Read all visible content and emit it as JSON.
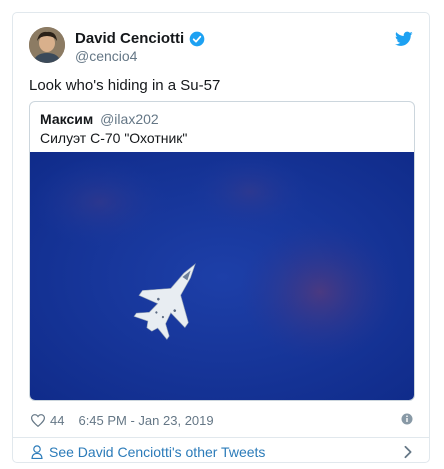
{
  "tweet": {
    "author": {
      "name": "David Cenciotti",
      "handle": "@cencio4"
    },
    "text": "Look who's hiding in a Su-57",
    "quoted": {
      "author_name": "Максим",
      "handle": "@ilax202",
      "text": "Силуэт С-70 \"Охотник\""
    },
    "likes": "44",
    "timestamp": "6:45 PM - Jan 23, 2019"
  },
  "footer": {
    "link_text": "See David Cenciotti's other Tweets"
  },
  "colors": {
    "link_blue": "#2b7bb9",
    "twitter_blue": "#1da1f2",
    "muted": "#657786",
    "border": "#e1e8ed"
  }
}
